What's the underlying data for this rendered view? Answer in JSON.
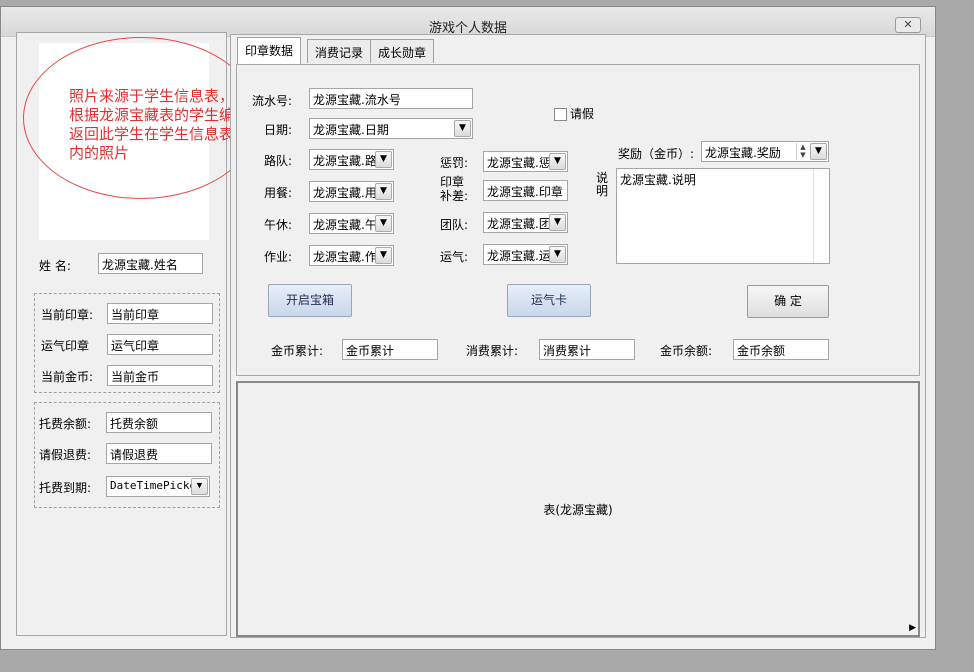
{
  "window": {
    "title": "游戏个人数据",
    "close_glyph": "✕"
  },
  "photo": {
    "note_lines": [
      "照片来源于学生信息表，",
      "根据龙源宝藏表的学生编号",
      "返回此学生在学生信息表",
      "内的照片"
    ]
  },
  "left": {
    "name_label": "姓  名:",
    "name_value": "龙源宝藏.姓名",
    "group1": [
      {
        "label": "当前印章:",
        "value": "当前印章"
      },
      {
        "label": "运气印章",
        "value": "运气印章"
      },
      {
        "label": "当前金币:",
        "value": "当前金币"
      }
    ],
    "group2": [
      {
        "label": "托费余额:",
        "value": "托费余额"
      },
      {
        "label": "请假退费:",
        "value": "请假退费"
      }
    ],
    "due_label": "托费到期:",
    "due_value": "DateTimePicker"
  },
  "tabs": [
    {
      "label": "印章数据",
      "active": true
    },
    {
      "label": "消费记录",
      "active": false
    },
    {
      "label": "成长勋章",
      "active": false
    }
  ],
  "form": {
    "serial_label": "流水号:",
    "serial_value": "龙源宝藏.流水号",
    "date_label": "日期:",
    "date_value": "龙源宝藏.日期",
    "leave_label": "请假",
    "col1": [
      {
        "label": "路队:",
        "value": "龙源宝藏.路"
      },
      {
        "label": "用餐:",
        "value": "龙源宝藏.用"
      },
      {
        "label": "午休:",
        "value": "龙源宝藏.午"
      },
      {
        "label": "作业:",
        "value": "龙源宝藏.作"
      }
    ],
    "col2": [
      {
        "label": "惩罚:",
        "value": "龙源宝藏.惩"
      },
      {
        "label": "印章\n补差:",
        "value": "龙源宝藏.印章"
      },
      {
        "label": "团队:",
        "value": "龙源宝藏.团"
      },
      {
        "label": "运气:",
        "value": "龙源宝藏.运"
      }
    ],
    "reward_label": "奖励（金币）:",
    "reward_value": "龙源宝藏.奖励",
    "desc_label": "说\n明",
    "desc_value": "龙源宝藏.说明",
    "btn_open_box": "开启宝箱",
    "btn_luck_card": "运气卡",
    "btn_confirm": "确  定",
    "gold_total_label": "金币累计:",
    "gold_total_value": "金币累计",
    "spend_total_label": "消费累计:",
    "spend_total_value": "消费累计",
    "gold_balance_label": "金币余额:",
    "gold_balance_value": "金币余额"
  },
  "grid": {
    "caption": "表(龙源宝藏)"
  }
}
